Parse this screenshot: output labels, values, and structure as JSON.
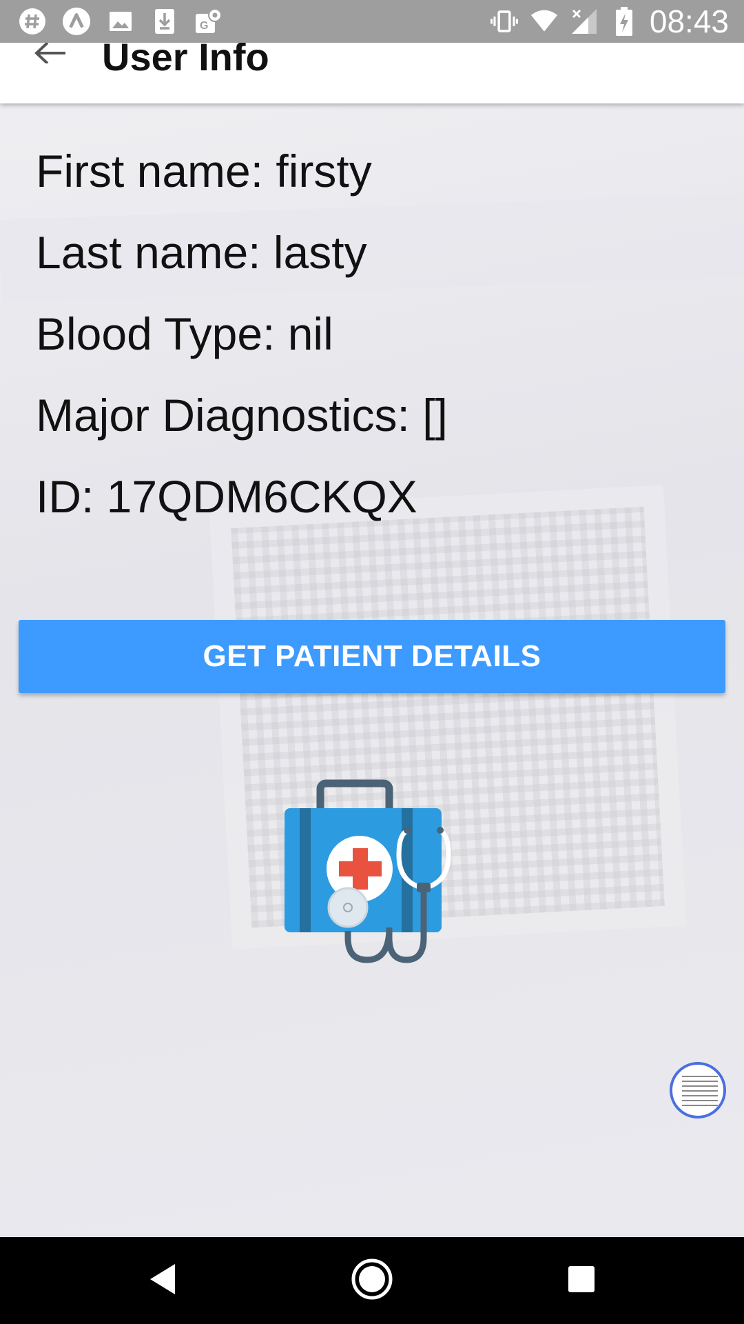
{
  "status_bar": {
    "time": "08:43",
    "icons": [
      "hash-icon",
      "a-circle-icon",
      "image-icon",
      "download-icon",
      "maps-icon",
      "vibrate-icon",
      "wifi-icon",
      "signal-icon",
      "battery-charging-icon"
    ]
  },
  "app_bar": {
    "title": "User Info",
    "back_icon": "arrow-back-icon"
  },
  "user_info": {
    "first_name": "First name: firsty",
    "last_name": "Last name: lasty",
    "blood_type": "Blood Type: nil",
    "major_diagnostics": "Major Diagnostics: []",
    "id": "ID: 17QDM6CKQX"
  },
  "actions": {
    "get_patient_details": "GET PATIENT DETAILS"
  },
  "illustration": {
    "icon": "medical-kit-icon"
  },
  "nav_bar": {
    "icons": [
      "back-triangle-icon",
      "home-circle-icon",
      "recents-square-icon"
    ]
  },
  "colors": {
    "primary_button": "#3d9bff",
    "status_bar": "#9e9e9e",
    "background": "#e6e6eb",
    "kit_blue": "#2d9be0",
    "kit_red": "#e8523f"
  }
}
